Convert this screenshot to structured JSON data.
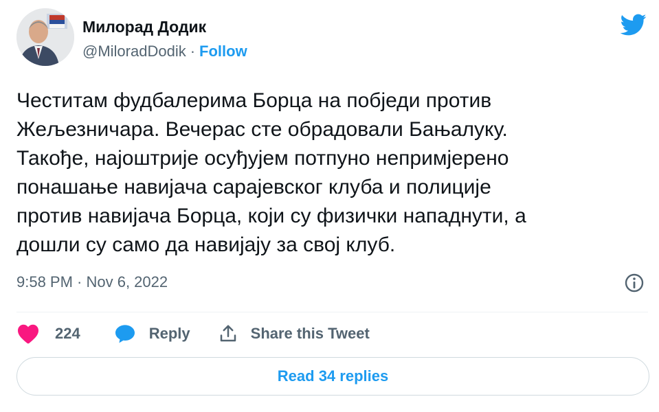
{
  "author": {
    "display_name": "Милорад Додик",
    "handle": "@MiloradDodik",
    "separator": "·",
    "follow_label": "Follow"
  },
  "tweet": {
    "lines": [
      "Честитам фудбалерима Борца на побједи против",
      "Жељезничара. Вечерас сте обрадовали Бањалуку.",
      "Такође, најоштрије осуђујем потпуно непримјерено",
      "понашање навијача сарајевског клуба и полиције",
      "против навијача Борца, који су физички нападнути, а",
      "дошли су само да навијају за свој клуб."
    ],
    "timestamp": "9:58 PM · Nov 6, 2022"
  },
  "actions": {
    "like_count": "224",
    "reply_label": "Reply",
    "share_label": "Share this Tweet"
  },
  "read_replies_label": "Read 34 replies",
  "icons": {
    "logo": "twitter-bird-icon",
    "info": "info-icon",
    "like": "heart-icon",
    "reply": "reply-bubble-icon",
    "share": "share-icon"
  },
  "colors": {
    "accent": "#1d9bf0",
    "like": "#f91880",
    "text": "#0f1419",
    "secondary": "#536471",
    "border": "#cfd9de"
  }
}
